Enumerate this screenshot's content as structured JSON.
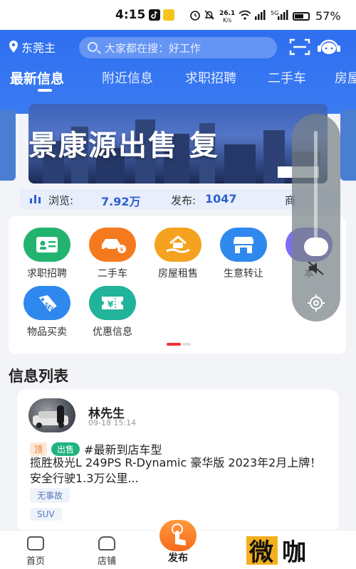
{
  "status_bar": {
    "time": "4:15",
    "net_speed_value": "26.1",
    "net_speed_unit": "K/s",
    "signal_label": "5G",
    "battery": "57%"
  },
  "header": {
    "location": "东莞主",
    "search_placeholder": "大家都在搜：好工作"
  },
  "tabs": [
    {
      "label": "最新信息",
      "active": true
    },
    {
      "label": "附近信息",
      "active": false
    },
    {
      "label": "求职招聘",
      "active": false
    },
    {
      "label": "二手车",
      "active": false
    },
    {
      "label": "房屋",
      "active": false
    }
  ],
  "banner": {
    "text": "景康源出售 复"
  },
  "stats": {
    "views_label": "浏览:",
    "views_value": "7.92万",
    "posts_label": "发布:",
    "posts_value": "1047",
    "merchants_label": "商"
  },
  "categories": [
    {
      "label": "求职招聘",
      "icon": "id-card-icon",
      "color": "#22b46e"
    },
    {
      "label": "二手车",
      "icon": "car-icon",
      "color": "#f57a1e"
    },
    {
      "label": "房屋租售",
      "icon": "house-hand-icon",
      "color": "#f5a21e"
    },
    {
      "label": "生意转让",
      "icon": "shop-icon",
      "color": "#2f88ee"
    },
    {
      "label": "本",
      "icon": "more-icon",
      "color": "#7b6ff0"
    },
    {
      "label": "物品买卖",
      "icon": "sell-tag-icon",
      "color": "#2f88ee"
    },
    {
      "label": "优惠信息",
      "icon": "ticket-icon",
      "color": "#22b49a"
    }
  ],
  "section_title": "信息列表",
  "post": {
    "name": "林先生",
    "date": "09-18 15:14",
    "tag_top": "顶",
    "tag_sale": "出售",
    "hashtag": "#最新到店车型",
    "body": "揽胜极光L 249PS R-Dynamic 豪华版 2023年2月上牌！ 安全行驶1.3万公里...",
    "chips": [
      "无事故",
      "SUV"
    ]
  },
  "bottom_nav": {
    "home": "首页",
    "shop": "店铺",
    "publish": "发布"
  },
  "watermark": "微咖"
}
